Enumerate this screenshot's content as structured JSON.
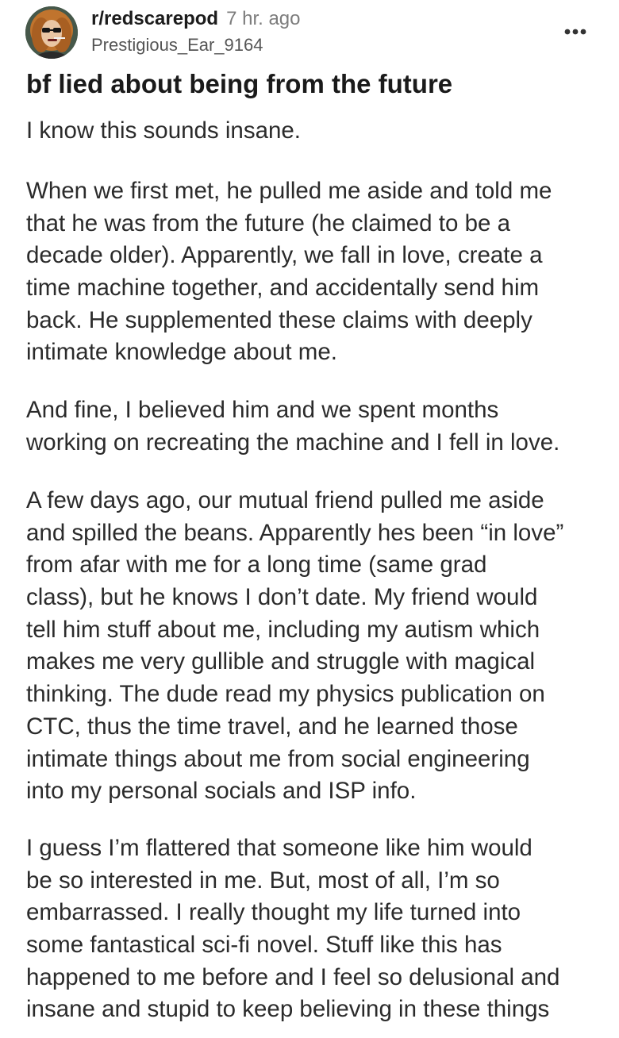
{
  "post": {
    "subreddit": "r/redscarepod",
    "time_ago": "7 hr. ago",
    "username": "Prestigious_Ear_9164",
    "more_icon": "more-horizontal-icon",
    "title": "bf lied about being from the future",
    "paragraphs": [
      [
        "I know this sounds insane."
      ],
      [
        "When we first met, he pulled me aside and told me",
        "that he was from the future (he claimed to be a",
        "decade older). Apparently, we fall in love, create a",
        "time machine together, and accidentally send him",
        "back. He supplemented these claims with deeply",
        "intimate knowledge about me."
      ],
      [
        "And fine, I believed him and we spent months",
        "working on recreating the machine and I fell in love."
      ],
      [
        "A few days ago, our mutual friend pulled me aside",
        "and spilled the beans. Apparently hes been “in love”",
        "from afar with me for a long time (same grad",
        "class), but he knows I don’t date. My friend would",
        "tell him stuff about me, including my autism which",
        "makes me very gullible and struggle with magical",
        "thinking. The dude read my physics publication on",
        "CTC, thus the time travel, and he learned those",
        "intimate things about me from social engineering",
        "into my personal socials and ISP info."
      ],
      [
        "I guess I’m flattered that someone like him would",
        "be so interested in me. But, most of all, I’m so",
        "embarrassed. I really thought my life turned into",
        "some fantastical sci-fi novel. Stuff like this has",
        "happened to me before and I feel so delusional and",
        "insane and stupid to keep believing in these things"
      ]
    ]
  },
  "colors": {
    "text": "#2b2b2b",
    "title": "#1a1a1a",
    "muted": "#7c7c7c",
    "username": "#555555",
    "background": "#ffffff"
  }
}
